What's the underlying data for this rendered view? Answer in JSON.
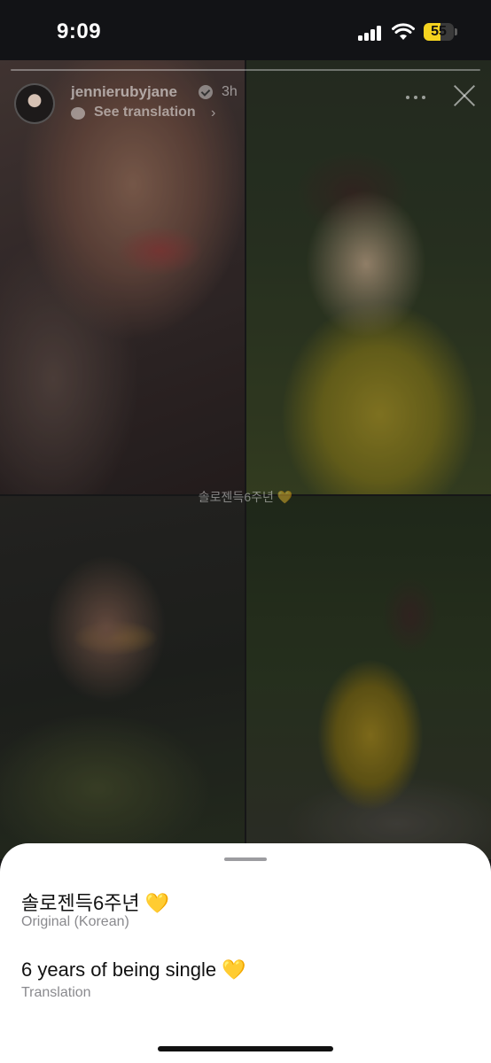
{
  "status_bar": {
    "time": "9:09",
    "battery": "55",
    "battery_level": 0.55,
    "battery_color": "#f5d31f"
  },
  "story": {
    "username": "jennierubyjane",
    "post_time": "3h",
    "see_translation": "See translation",
    "caption": "솔로젠득6주년 💛",
    "icons": [
      "avatar",
      "verified-badge-icon",
      "chat-bubble-icon",
      "chevron-right-icon",
      "more-icon",
      "close-icon"
    ]
  },
  "translation_sheet": {
    "original_text": "솔로젠득6주년 💛",
    "original_label": "Original (Korean)",
    "translated_text": "6 years of being single 💛",
    "translated_label": "Translation"
  }
}
